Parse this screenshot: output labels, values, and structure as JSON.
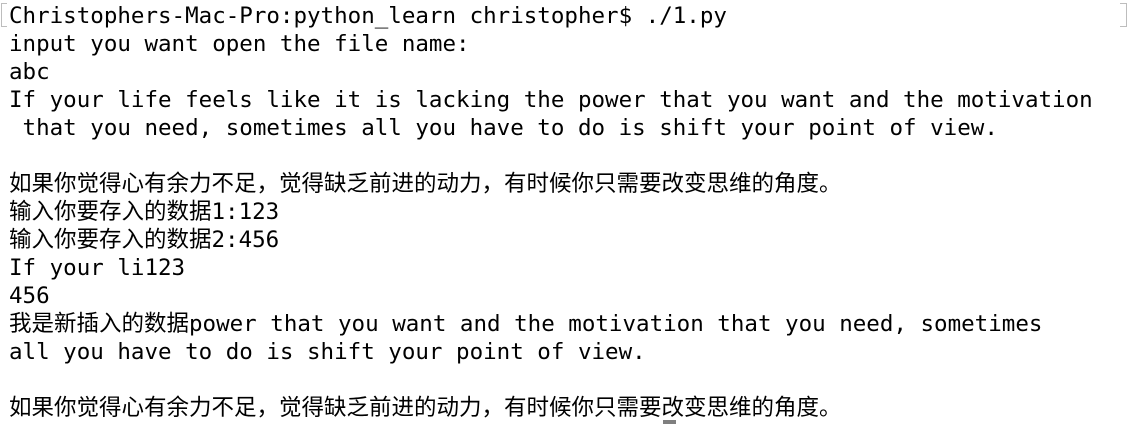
{
  "terminal": {
    "lines": [
      "Christophers-Mac-Pro:python_learn christopher$ ./1.py",
      "input you want open the file name:",
      "abc",
      "If your life feels like it is lacking the power that you want and the motivation",
      " that you need, sometimes all you have to do is shift your point of view.",
      "",
      "如果你觉得心有余力不足，觉得缺乏前进的动力，有时候你只需要改变思维的角度。",
      "输入你要存入的数据1:123",
      "输入你要存入的数据2:456",
      "If your li123",
      "456",
      "我是新插入的数据power that you want and the motivation that you need, sometimes",
      "all you have to do is shift your point of view.",
      "",
      "如果你觉得心有余力不足，觉得缺乏前进的动力，有时候你只需要改变思维的角度。"
    ]
  }
}
